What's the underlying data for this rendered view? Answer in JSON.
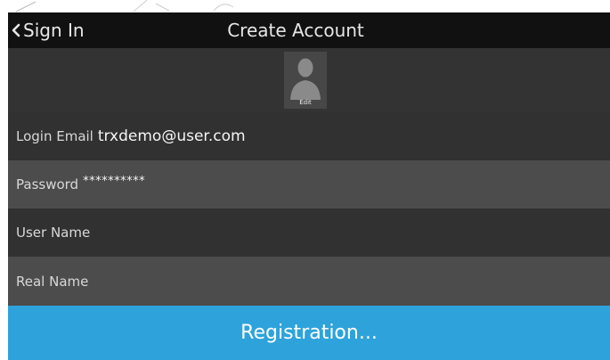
{
  "navbar": {
    "back_label": "Sign In",
    "title": "Create Account"
  },
  "avatar": {
    "edit_label": "Edit"
  },
  "fields": {
    "email_label": "Login Email",
    "email_value": "trxdemo@user.com",
    "password_label": "Password",
    "password_value": "**********",
    "username_label": "User Name",
    "realname_label": "Real Name"
  },
  "actions": {
    "register_label": "Registration..."
  },
  "colors": {
    "navbar_bg": "#111111",
    "row_dark": "#313131",
    "row_light": "#4c4c4c",
    "accent": "#2ea3db"
  }
}
